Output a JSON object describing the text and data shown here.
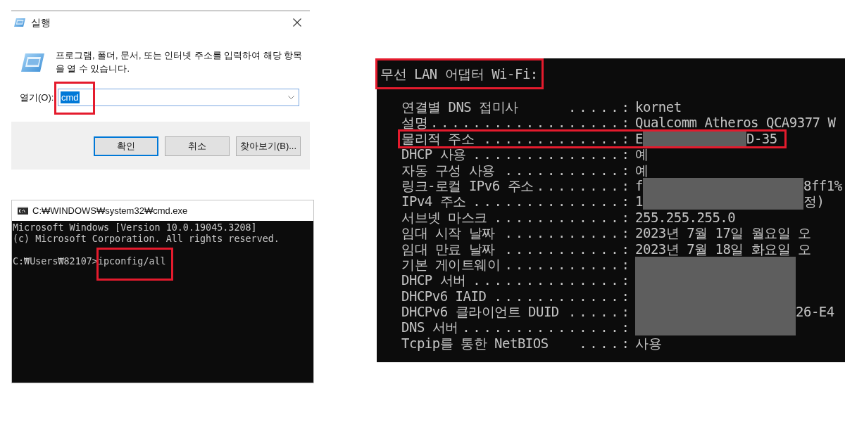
{
  "run_dialog": {
    "title": "실행",
    "description": "프로그램, 폴더, 문서, 또는 인터넷 주소를 입력하여 해당 항목을 열 수 있습니다.",
    "open_field": {
      "label": "열기(O):",
      "value": "cmd",
      "value_selected": true,
      "highlighted": true
    },
    "buttons": [
      {
        "label": "확인",
        "default": true
      },
      {
        "label": "취소",
        "default": false
      },
      {
        "label": "찾아보기(B)...",
        "default": false
      }
    ]
  },
  "cmd_window": {
    "title": "C:₩WINDOWS₩system32₩cmd.exe",
    "lines": [
      {
        "kind": "output",
        "text": "Microsoft Windows [Version 10.0.19045.3208]"
      },
      {
        "kind": "output",
        "text": "(c) Microsoft Corporation. All rights reserved."
      },
      {
        "kind": "prompt",
        "prompt": "C:₩Users₩82107>",
        "command": "ipconfig/all",
        "highlighted": true
      }
    ]
  },
  "wifi_panel": {
    "header": {
      "text": "무선 LAN 어댑터 Wi-Fi:",
      "highlighted": true
    },
    "rows": [
      {
        "kind": "plain",
        "label": "연결별 DNS 접미사",
        "leader": ". . . . . :",
        "value": "kornet",
        "highlighted": false
      },
      {
        "kind": "plain",
        "label": "설명",
        "leader": ". . . . . . . . . . . . . . . . . . :",
        "value": "Qualcomm Atheros QCA9377 W",
        "highlighted": false
      },
      {
        "kind": "shortmask",
        "label": "물리적 주소",
        "leader": ". . . . . . . . . . . . . :",
        "value": "E",
        "value_after": "D-35",
        "highlighted": true
      },
      {
        "kind": "plain",
        "label": "DHCP 사용",
        "leader": ". . . . . . . . . . . . . . :",
        "value": "예",
        "highlighted": false
      },
      {
        "kind": "plain",
        "label": "자동 구성 사용",
        "leader": ". . . . . . . . . . . :",
        "value": "예",
        "highlighted": false
      },
      {
        "kind": "masked",
        "label": "링크-로컬 IPv6 주소",
        "leader": ". . . . . . . . :",
        "value": "f",
        "value_after": "8ff1%",
        "highlighted": false
      },
      {
        "kind": "masked",
        "label": "IPv4 주소",
        "leader": ". . . . . . . . . . . . . . :",
        "value": "1",
        "value_after": "정)",
        "highlighted": false
      },
      {
        "kind": "plain",
        "label": "서브넷 마스크",
        "leader": ". . . . . . . . . . . . :",
        "value": "255.255.255.0",
        "highlighted": false
      },
      {
        "kind": "plain",
        "label": "임대 시작 날짜",
        "leader": ". . . . . . . . . . . :",
        "value": "2023년 7월 17일 월요일 오",
        "highlighted": false
      },
      {
        "kind": "plain",
        "label": "임대 만료 날짜",
        "leader": ". . . . . . . . . . . :",
        "value": "2023년 7월 18일 화요일 오",
        "highlighted": false
      },
      {
        "kind": "masked",
        "label": "기본 게이트웨이",
        "leader": ". . . . . . . . . . . :",
        "highlighted": false
      },
      {
        "kind": "masked",
        "label": "DHCP 서버",
        "leader": ". . . . . . . . . . . . . . :",
        "highlighted": false
      },
      {
        "kind": "masked",
        "label": "DHCPv6 IAID",
        "leader": ". . . . . . . . . . . . :",
        "highlighted": false
      },
      {
        "kind": "masked",
        "label": "DHCPv6 클라이언트 DUID",
        "leader": ". . . . . :",
        "value_after": "26-E4",
        "highlighted": false
      },
      {
        "kind": "masked",
        "label": "DNS 서버",
        "leader": ". . . . . . . . . . . . . . . :",
        "highlighted": false
      },
      {
        "kind": "plain",
        "label": "Tcpip를 통한 NetBIOS",
        "leader": ". . . . :",
        "value": "사용",
        "highlighted": false
      }
    ]
  }
}
